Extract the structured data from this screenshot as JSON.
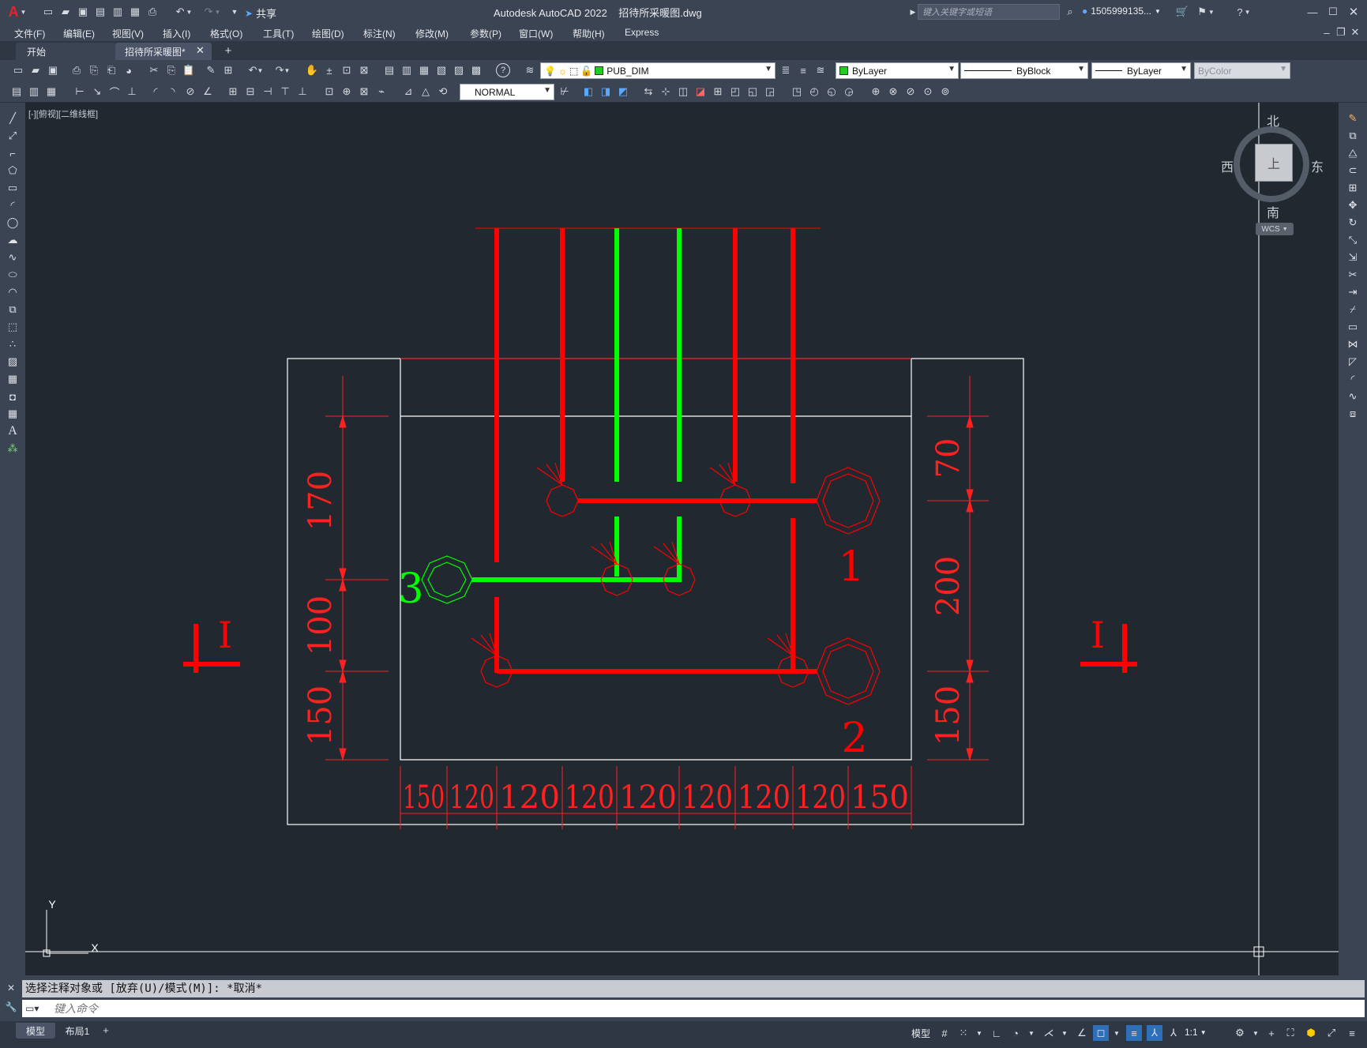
{
  "window": {
    "title": "Autodesk AutoCAD 2022    招待所采暖图.dwg",
    "share_label": "共享",
    "search_placeholder": "键入关键字或短语",
    "user": "1505999135...",
    "min_icon": "minimize-icon",
    "max_icon": "maximize-icon",
    "close_icon": "close-icon"
  },
  "menu": {
    "items": [
      "文件(F)",
      "编辑(E)",
      "视图(V)",
      "插入(I)",
      "格式(O)",
      "工具(T)",
      "绘图(D)",
      "标注(N)",
      "修改(M)",
      "参数(P)",
      "窗口(W)",
      "帮助(H)",
      "Express"
    ]
  },
  "tabs": {
    "items": [
      {
        "label": "开始",
        "active": false
      },
      {
        "label": "招待所采暖图*",
        "active": true
      }
    ]
  },
  "toolbar": {
    "layer": "PUB_DIM",
    "layer_color": "#22cc22",
    "color": "ByLayer",
    "linetype": "ByBlock",
    "lineweight": "ByLayer",
    "plotstyle": "ByColor",
    "dimstyle": "NORMAL"
  },
  "viewport": {
    "label": "[-][俯视][二维线框]",
    "background": "#212830"
  },
  "viewcube": {
    "north": "北",
    "south": "南",
    "east": "东",
    "west": "西",
    "face": "上",
    "wcs": "WCS"
  },
  "ucs": {
    "x": "X",
    "y": "Y"
  },
  "drawing": {
    "colors": {
      "red": "#ff0000",
      "green": "#00ff00",
      "white": "#ffffff",
      "dim_red": "#ff2020"
    },
    "left_dims": [
      "170",
      "100",
      "150"
    ],
    "right_dims": [
      "70",
      "200",
      "150"
    ],
    "bottom_dims": [
      "150",
      "120",
      "120",
      "120",
      "120",
      "120",
      "120",
      "120",
      "150"
    ],
    "labels": {
      "one": "1",
      "two": "2",
      "three": "3"
    },
    "section_mark": "I"
  },
  "command": {
    "history": "选择注释对象或 [放弃(U)/模式(M)]: *取消*",
    "placeholder": "键入命令"
  },
  "layouts": {
    "items": [
      "模型",
      "布局1"
    ]
  },
  "status": {
    "model": "模型",
    "scale": "1:1"
  }
}
